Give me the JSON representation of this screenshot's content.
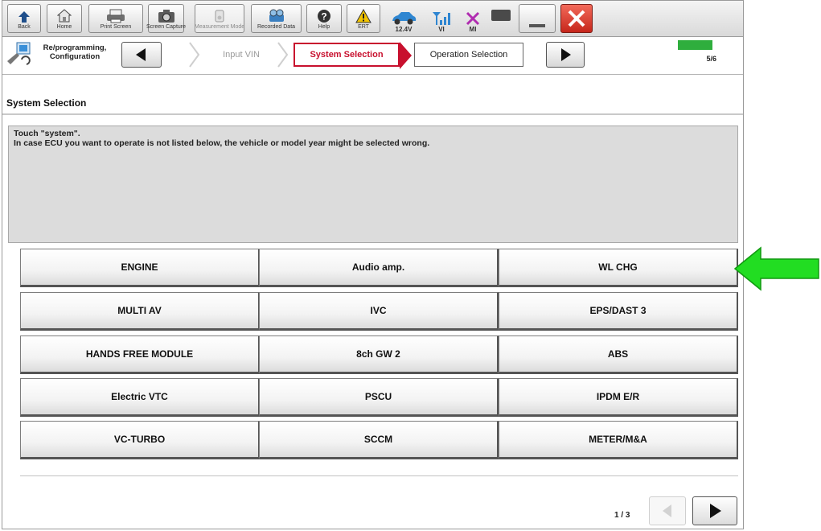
{
  "toolbar": {
    "back": "Back",
    "home": "Home",
    "print_screen": "Print Screen",
    "screen_capture": "Screen Capture",
    "measurement_mode": "Measurement Mode",
    "recorded_data": "Recorded Data",
    "help": "Help",
    "ert": "ERT",
    "voltage": "12.4V",
    "vi": "VI",
    "mi": "MI"
  },
  "breadcrumb": {
    "module": "Re/programming, Configuration",
    "step_input_vin": "Input VIN",
    "step_system_selection": "System Selection",
    "step_operation_selection": "Operation Selection",
    "progress": "5/6",
    "progress_fraction": 0.83
  },
  "section_title": "System Selection",
  "instructions": {
    "line1": "Touch \"system\".",
    "line2": "In case ECU you want to operate is not listed below, the vehicle or model year might be selected wrong."
  },
  "systems": [
    "ENGINE",
    "Audio amp.",
    "WL CHG",
    "MULTI AV",
    "IVC",
    "EPS/DAST 3",
    "HANDS FREE MODULE",
    "8ch GW 2",
    "ABS",
    "Electric VTC",
    "PSCU",
    "IPDM E/R",
    "VC-TURBO",
    "SCCM",
    "METER/M&A"
  ],
  "pager": {
    "text": "1 / 3"
  },
  "colors": {
    "active_step": "#c8102e",
    "progress_fill": "#2fae3d",
    "close_button": "#e0362f",
    "arrow": "#22dd22"
  }
}
